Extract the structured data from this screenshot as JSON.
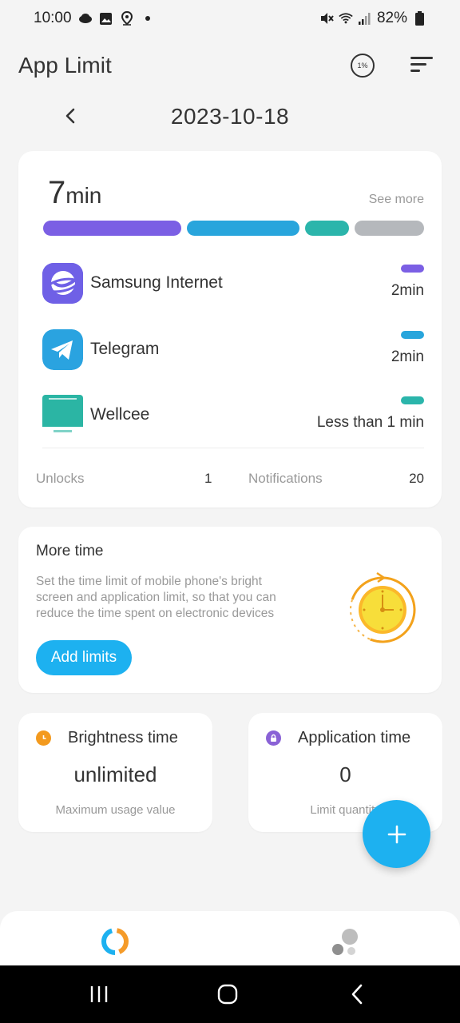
{
  "status_bar": {
    "time": "10:00",
    "battery": "82%"
  },
  "header": {
    "title": "App Limit",
    "usage_percent_icon": "1%"
  },
  "date": "2023-10-18",
  "usage": {
    "total_value": "7",
    "total_unit": "min",
    "see_more": "See more",
    "bar_segments": [
      {
        "color": "#7b5fe4",
        "share": 0.38
      },
      {
        "color": "#28a5dc",
        "share": 0.31
      },
      {
        "color": "#2bb5ab",
        "share": 0.12
      },
      {
        "color": "#b5b8bc",
        "share": 0.19
      }
    ],
    "apps": [
      {
        "name": "Samsung Internet",
        "time": "2min",
        "color": "#7b5fe4",
        "icon": "samsung-internet-icon"
      },
      {
        "name": "Telegram",
        "time": "2min",
        "color": "#28a5dc",
        "icon": "telegram-icon"
      },
      {
        "name": "Wellcee",
        "time": "Less than 1 min",
        "color": "#2bb5ab",
        "icon": "wellcee-icon"
      }
    ],
    "unlocks_label": "Unlocks",
    "unlocks_value": "1",
    "notifications_label": "Notifications",
    "notifications_value": "20"
  },
  "more_time": {
    "title": "More time",
    "description": "Set the time limit of mobile phone's bright screen and application limit, so that you can reduce the time spent on electronic devices",
    "button": "Add limits"
  },
  "brightness": {
    "title": "Brightness time",
    "value": "unlimited",
    "sub": "Maximum usage value"
  },
  "application": {
    "title": "Application time",
    "value": "0",
    "sub": "Limit quantity"
  },
  "colors": {
    "accent": "#1db1f0",
    "brightness_dot": "#f39a1e",
    "application_dot": "#8a62d6"
  }
}
